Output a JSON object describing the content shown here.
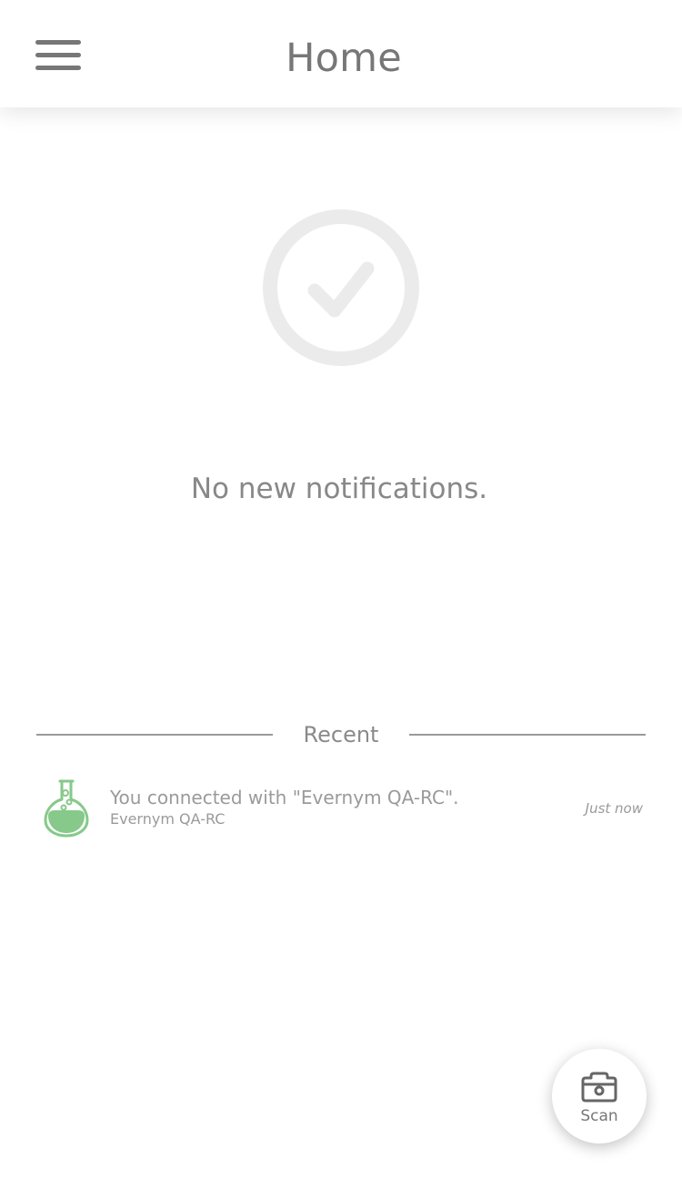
{
  "header": {
    "title": "Home",
    "menu_icon": "hamburger-menu-icon"
  },
  "empty_state": {
    "icon": "check-circle-icon",
    "message": "No new notifications."
  },
  "recent": {
    "label": "Recent",
    "items": [
      {
        "icon": "flask-icon",
        "title": "You connected with \"Evernym QA-RC\".",
        "subtitle": "Evernym QA-RC",
        "time": "Just now"
      }
    ]
  },
  "scan": {
    "icon": "camera-icon",
    "label": "Scan"
  },
  "colors": {
    "text": "#777777",
    "muted": "#9a9a9a",
    "icon_gray": "#ebebeb",
    "flask_green": "#86c98a"
  }
}
